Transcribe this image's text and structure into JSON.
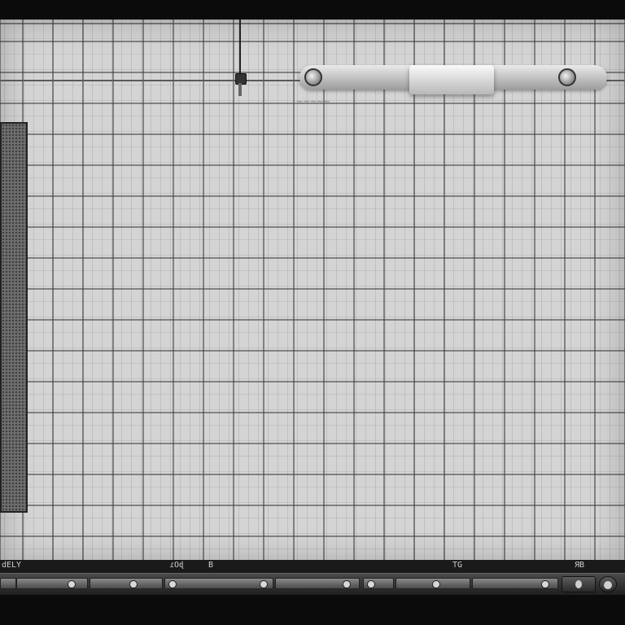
{
  "timeline": {
    "ruler_labels": [
      "dELY",
      "ɾOɖ",
      "B",
      "TG",
      "ЯB"
    ]
  },
  "colors": {
    "grid_background": "#d4d4d4",
    "frame": "#0b0b0b",
    "transport": "#2a2a2a"
  },
  "icons": {
    "playhead": "playhead-marker-icon",
    "knob": "circle-knob-icon",
    "record": "record-icon"
  }
}
